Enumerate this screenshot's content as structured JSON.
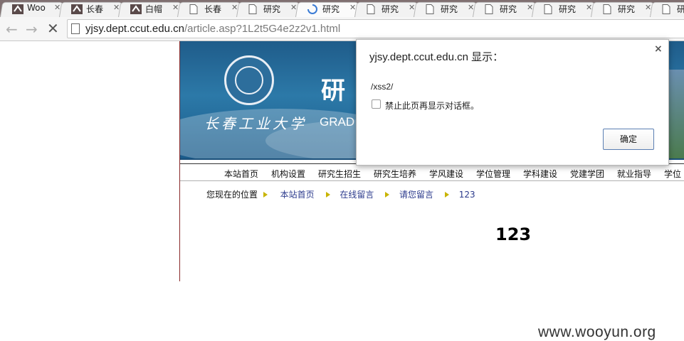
{
  "browser": {
    "tabs": [
      {
        "title": "Woo",
        "favicon": "wooyun-icon"
      },
      {
        "title": "长春",
        "favicon": "wooyun-icon"
      },
      {
        "title": "白帽",
        "favicon": "wooyun-icon"
      },
      {
        "title": "长春",
        "favicon": "page-icon"
      },
      {
        "title": "研究",
        "favicon": "page-icon"
      },
      {
        "title": "研究",
        "favicon": "loading-spinner-icon"
      },
      {
        "title": "研究",
        "favicon": "page-icon"
      },
      {
        "title": "研究",
        "favicon": "page-icon"
      },
      {
        "title": "研究",
        "favicon": "page-icon"
      },
      {
        "title": "研究",
        "favicon": "page-icon"
      },
      {
        "title": "研究",
        "favicon": "page-icon"
      },
      {
        "title": "研",
        "favicon": "page-icon"
      }
    ],
    "url_host": "yjsy.dept.ccut.edu.cn",
    "url_path": "/article.asp?1L2t5G4e2z2v1.html"
  },
  "site": {
    "school_name": "长春工业大学",
    "title_glyph": "研",
    "title_en": "GRAD",
    "nav": [
      "本站首页",
      "机构设置",
      "研究生招生",
      "研究生培养",
      "学风建设",
      "学位管理",
      "学科建设",
      "党建学团",
      "就业指导",
      "学位"
    ],
    "breadcrumb": {
      "label": "您现在的位置",
      "links": [
        "本站首页",
        "在线留言",
        "请您留言"
      ],
      "current": "123"
    },
    "article_title": "123"
  },
  "dialog": {
    "title": "yjsy.dept.ccut.edu.cn 显示：",
    "message": "/xss2/",
    "checkbox_label": "禁止此页再显示对话框。",
    "ok_label": "确定",
    "close_glyph": "×"
  },
  "watermark": "www.wooyun.org",
  "colors": {
    "tabstrip": "#7f6f70",
    "banner": "#1f5c8a",
    "link": "#2b3a8c",
    "arrow": "#c8b400"
  }
}
